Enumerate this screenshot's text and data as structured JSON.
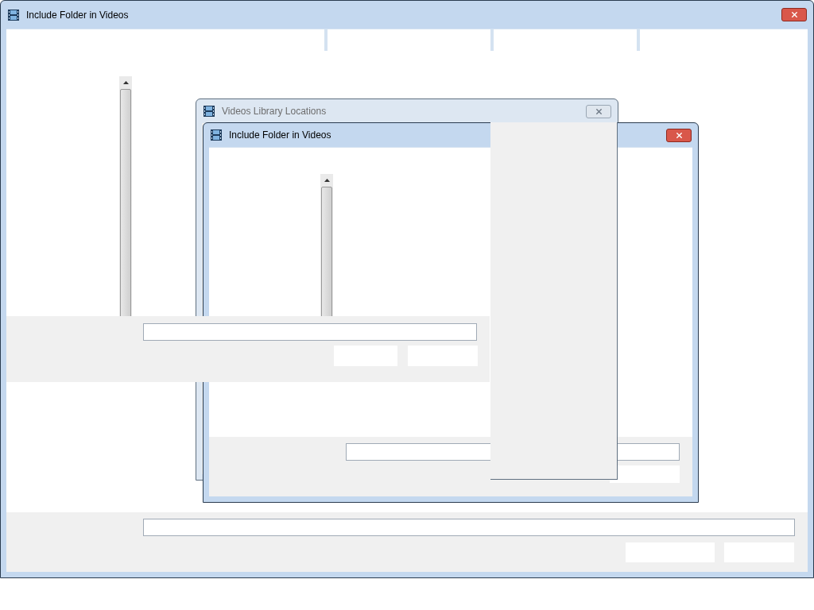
{
  "windows": [
    {
      "title": "Include Folder in Videos",
      "active": true
    },
    {
      "title": "Videos Library Locations",
      "active": false
    },
    {
      "title": "Include Folder in Videos",
      "active": true
    }
  ]
}
